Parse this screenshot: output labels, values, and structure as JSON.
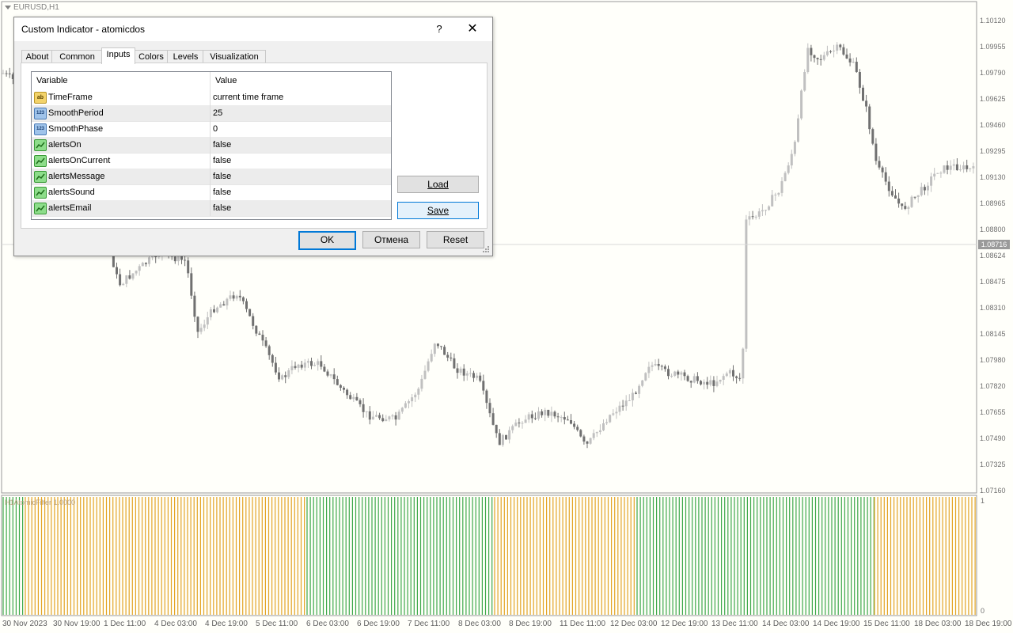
{
  "chart": {
    "symbol": "EURUSD,H1",
    "current_price": "1.08716",
    "price_axis": [
      "1.10120",
      "1.09955",
      "1.09790",
      "1.09625",
      "1.09460",
      "1.09295",
      "1.09130",
      "1.08965",
      "1.08800",
      "1.08624",
      "1.08475",
      "1.08310",
      "1.08145",
      "1.07980",
      "1.07820",
      "1.07655",
      "1.07490",
      "1.07325",
      "1.07160"
    ],
    "time_axis": [
      "30 Nov 2023",
      "30 Nov 19:00",
      "1 Dec 11:00",
      "4 Dec 03:00",
      "4 Dec 19:00",
      "5 Dec 11:00",
      "6 Dec 03:00",
      "6 Dec 19:00",
      "7 Dec 11:00",
      "8 Dec 03:00",
      "8 Dec 19:00",
      "11 Dec 11:00",
      "12 Dec 03:00",
      "12 Dec 19:00",
      "13 Dec 11:00",
      "14 Dec 03:00",
      "14 Dec 19:00",
      "15 Dec 11:00",
      "18 Dec 03:00",
      "18 Dec 19:00"
    ],
    "colors": {
      "bull": "#c0c0c0",
      "bear": "#707070",
      "background": "#fffffa"
    }
  },
  "indicator": {
    "title": "H1AtomicFilter 1.0000",
    "axis_top": "1",
    "axis_bottom": "0",
    "colors": {
      "up": "#3da84a",
      "down": "#e3a425"
    }
  },
  "dialog": {
    "title": "Custom Indicator - atomicdos",
    "help": "?",
    "close": "✕",
    "tabs": [
      {
        "label": "About"
      },
      {
        "label": "Common"
      },
      {
        "label": "Inputs",
        "active": true
      },
      {
        "label": "Colors"
      },
      {
        "label": "Levels"
      },
      {
        "label": "Visualization"
      }
    ],
    "grid": {
      "col_variable": "Variable",
      "col_value": "Value",
      "rows": [
        {
          "type": "ab",
          "icon": "string-icon",
          "name": "TimeFrame",
          "value": "current time frame"
        },
        {
          "type": "num",
          "icon": "number-icon",
          "name": "SmoothPeriod",
          "value": "25"
        },
        {
          "type": "num",
          "icon": "number-icon",
          "name": "SmoothPhase",
          "value": "0"
        },
        {
          "type": "bool",
          "icon": "boolean-icon",
          "name": "alertsOn",
          "value": "false"
        },
        {
          "type": "bool",
          "icon": "boolean-icon",
          "name": "alertsOnCurrent",
          "value": "false"
        },
        {
          "type": "bool",
          "icon": "boolean-icon",
          "name": "alertsMessage",
          "value": "false"
        },
        {
          "type": "bool",
          "icon": "boolean-icon",
          "name": "alertsSound",
          "value": "false"
        },
        {
          "type": "bool",
          "icon": "boolean-icon",
          "name": "alertsEmail",
          "value": "false"
        }
      ]
    },
    "load": "Load",
    "save": "Save",
    "ok": "OK",
    "cancel": "Отмена",
    "reset": "Reset"
  }
}
